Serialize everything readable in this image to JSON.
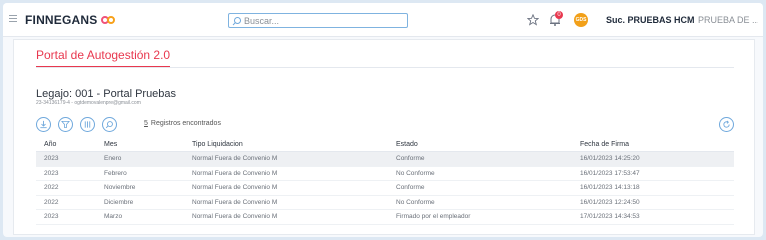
{
  "header": {
    "brand": "FINNEGANS",
    "search_placeholder": "Buscar...",
    "notification_count": "0",
    "avatar_initials": "GDS",
    "branch": "Suc. PRUEBAS HCM",
    "company": "PRUEBA DE ..."
  },
  "portal": {
    "tab_label": "Portal de Autogestión 2.0",
    "legajo_title": "Legajo: 001 - Portal Pruebas",
    "legajo_subtitle": "23-34136179-4 - ogtdemovalenpre@gmail.com"
  },
  "toolbar": {
    "icons": [
      "download-icon",
      "filter-icon",
      "columns-icon",
      "search-icon"
    ],
    "records_count": "5",
    "records_label": "Registros encontrados",
    "refresh_icon": "refresh-icon"
  },
  "table": {
    "headers": [
      "Año",
      "Mes",
      "Tipo Liquidacion",
      "Estado",
      "Fecha de Firma"
    ],
    "rows": [
      [
        "2023",
        "Enero",
        "Normal Fuera de Convenio M",
        "Conforme",
        "16/01/2023 14:25:20"
      ],
      [
        "2023",
        "Febrero",
        "Normal Fuera de Convenio M",
        "No Conforme",
        "16/01/2023 17:53:47"
      ],
      [
        "2022",
        "Noviembre",
        "Normal Fuera de Convenio M",
        "Conforme",
        "16/01/2023 14:13:18"
      ],
      [
        "2022",
        "Diciembre",
        "Normal Fuera de Convenio M",
        "No Conforme",
        "16/01/2023 12:24:50"
      ],
      [
        "2023",
        "Marzo",
        "Normal Fuera de Convenio M",
        "Firmado por el empleador",
        "17/01/2023 14:34:53"
      ]
    ]
  },
  "colors": {
    "accent": "#e8384f",
    "link_blue": "#6fa8dc",
    "brand_orange": "#f2a019"
  }
}
